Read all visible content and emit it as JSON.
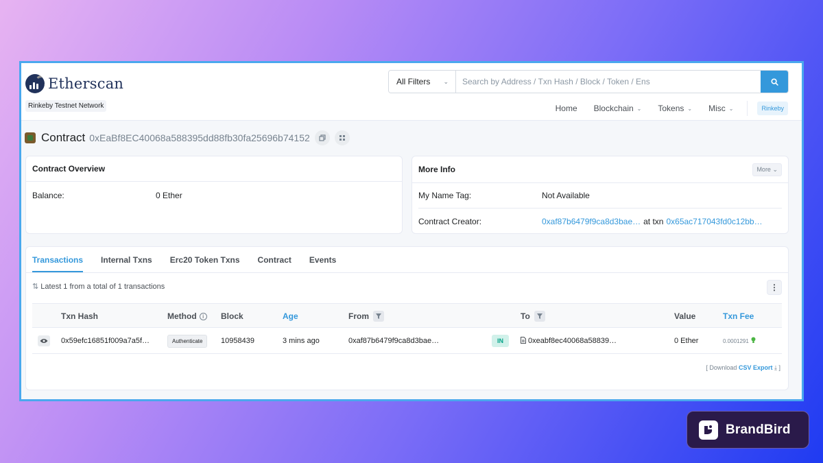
{
  "header": {
    "logo_text": "Etherscan",
    "network_label": "Rinkeby Testnet Network",
    "search": {
      "filter_label": "All Filters",
      "placeholder": "Search by Address / Txn Hash / Block / Token / Ens",
      "button_icon": "search-icon"
    },
    "nav": [
      {
        "label": "Home",
        "has_caret": false
      },
      {
        "label": "Blockchain",
        "has_caret": true
      },
      {
        "label": "Tokens",
        "has_caret": true
      },
      {
        "label": "Misc",
        "has_caret": true
      }
    ],
    "network_button": "Rinkeby"
  },
  "contract": {
    "label": "Contract",
    "address": "0xEaBf8EC40068a588395dd88fb30fa25696b74152"
  },
  "overview": {
    "title": "Contract Overview",
    "balance_label": "Balance:",
    "balance_value": "0 Ether"
  },
  "more_info": {
    "title": "More Info",
    "more_button": "More",
    "name_tag_label": "My Name Tag:",
    "name_tag_value": "Not Available",
    "creator_label": "Contract Creator:",
    "creator_address": "0xaf87b6479f9ca8d3bae…",
    "at_txn_label": "at txn",
    "creator_txn": "0x65ac717043fd0c12bb…"
  },
  "tabs": [
    "Transactions",
    "Internal Txns",
    "Erc20 Token Txns",
    "Contract",
    "Events"
  ],
  "transactions": {
    "summary": "Latest 1 from a total of 1 transactions",
    "columns": {
      "txn_hash": "Txn Hash",
      "method": "Method",
      "block": "Block",
      "age": "Age",
      "from": "From",
      "to": "To",
      "value": "Value",
      "txn_fee": "Txn Fee"
    },
    "rows": [
      {
        "txn_hash": "0x59efc16851f009a7a5f…",
        "method": "Authenticate",
        "block": "10958439",
        "age": "3 mins ago",
        "from": "0xaf87b6479f9ca8d3bae…",
        "direction": "IN",
        "to": "0xeabf8ec40068a58839…",
        "value": "0 Ether",
        "txn_fee": "0.0001291"
      }
    ],
    "download_prefix": "[ Download",
    "download_link": "CSV Export",
    "download_suffix": "]"
  },
  "brand": {
    "name": "BrandBird"
  },
  "colors": {
    "accent": "#3498db",
    "navy": "#21325b",
    "in_badge": "#00a186",
    "frame_border": "#4aa8ee"
  }
}
